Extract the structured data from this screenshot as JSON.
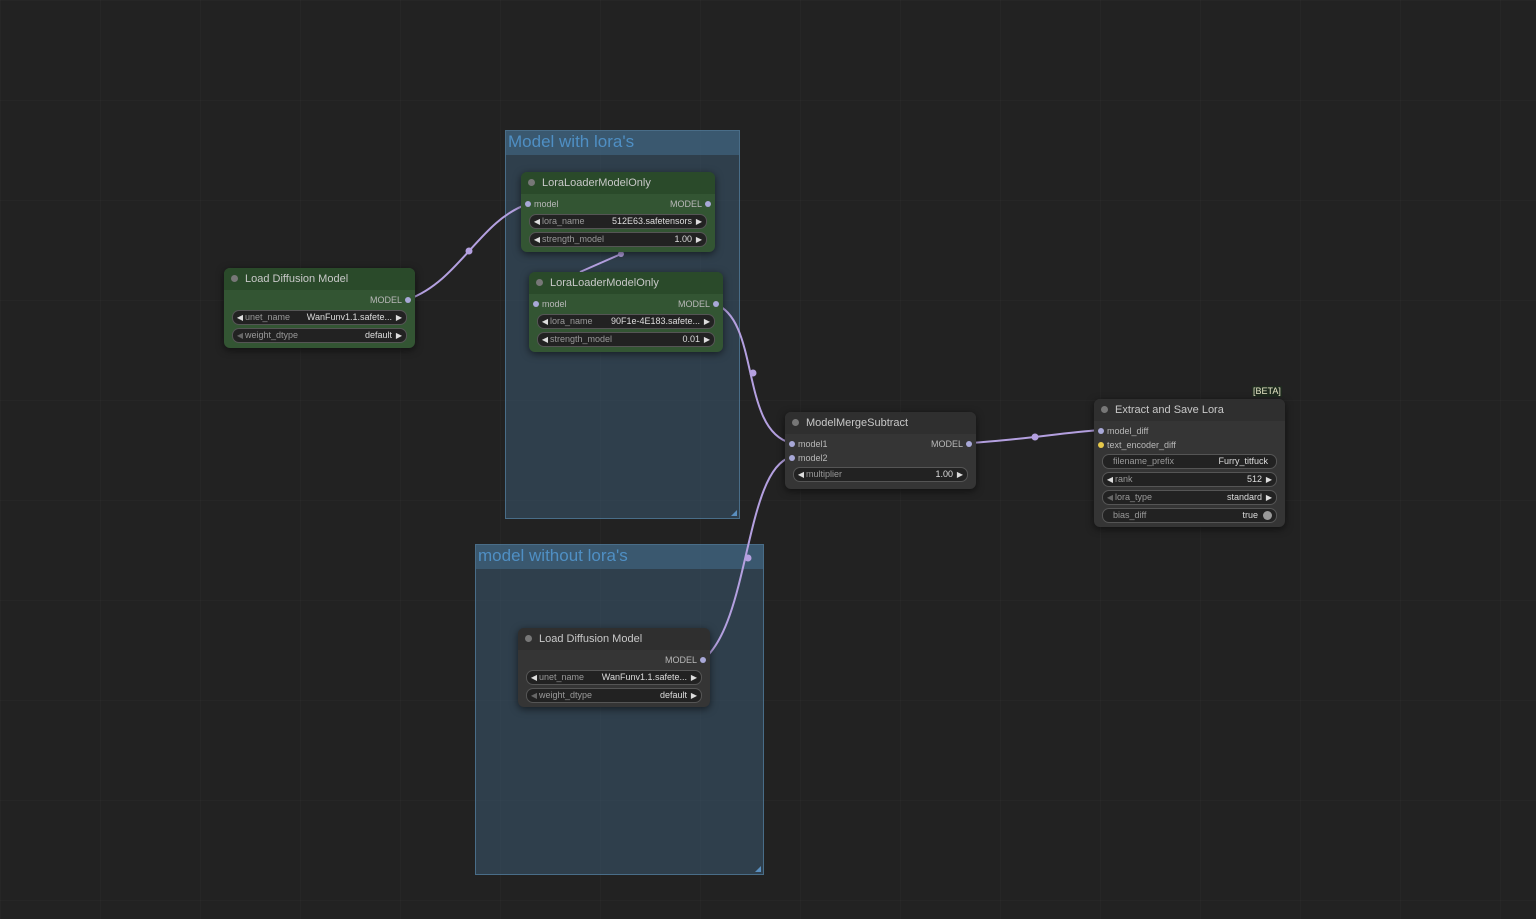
{
  "groups": {
    "with_loras": {
      "title": "Model with lora's"
    },
    "without_loras": {
      "title": "model without lora's"
    }
  },
  "nodes": {
    "load_diffusion_a": {
      "title": "Load Diffusion Model",
      "output": "MODEL",
      "widgets": {
        "unet_name": {
          "label": "unet_name",
          "value": "WanFunv1.1.safete..."
        },
        "weight_dtype": {
          "label": "weight_dtype",
          "value": "default"
        }
      }
    },
    "lora_loader_1": {
      "title": "LoraLoaderModelOnly",
      "input": "model",
      "output": "MODEL",
      "widgets": {
        "lora_name": {
          "label": "lora_name",
          "value": "512E63.safetensors"
        },
        "strength_model": {
          "label": "strength_model",
          "value": "1.00"
        }
      }
    },
    "lora_loader_2": {
      "title": "LoraLoaderModelOnly",
      "input": "model",
      "output": "MODEL",
      "widgets": {
        "lora_name": {
          "label": "lora_name",
          "value": "90F1e-4E183.safete..."
        },
        "strength_model": {
          "label": "strength_model",
          "value": "0.01"
        }
      }
    },
    "load_diffusion_b": {
      "title": "Load Diffusion Model",
      "output": "MODEL",
      "widgets": {
        "unet_name": {
          "label": "unet_name",
          "value": "WanFunv1.1.safete..."
        },
        "weight_dtype": {
          "label": "weight_dtype",
          "value": "default"
        }
      }
    },
    "model_merge_subtract": {
      "title": "ModelMergeSubtract",
      "inputs": [
        "model1",
        "model2"
      ],
      "output": "MODEL",
      "widgets": {
        "multiplier": {
          "label": "multiplier",
          "value": "1.00"
        }
      }
    },
    "extract_save_lora": {
      "title": "Extract and Save Lora",
      "badge": "[BETA]",
      "inputs": [
        "model_diff",
        "text_encoder_diff"
      ],
      "widgets": {
        "filename_prefix": {
          "label": "filename_prefix",
          "value": "Furry_titfuck"
        },
        "rank": {
          "label": "rank",
          "value": "512"
        },
        "lora_type": {
          "label": "lora_type",
          "value": "standard"
        },
        "bias_diff": {
          "label": "bias_diff",
          "value": "true"
        }
      }
    }
  },
  "colors": {
    "canvas": "#222222",
    "group_fill": "#3a5870",
    "group_title": "#4f8fc4",
    "node_green": "#335533",
    "node_gray": "#353535",
    "wire_model": "#b4a0e0",
    "socket_clip": "#e6c84a"
  }
}
